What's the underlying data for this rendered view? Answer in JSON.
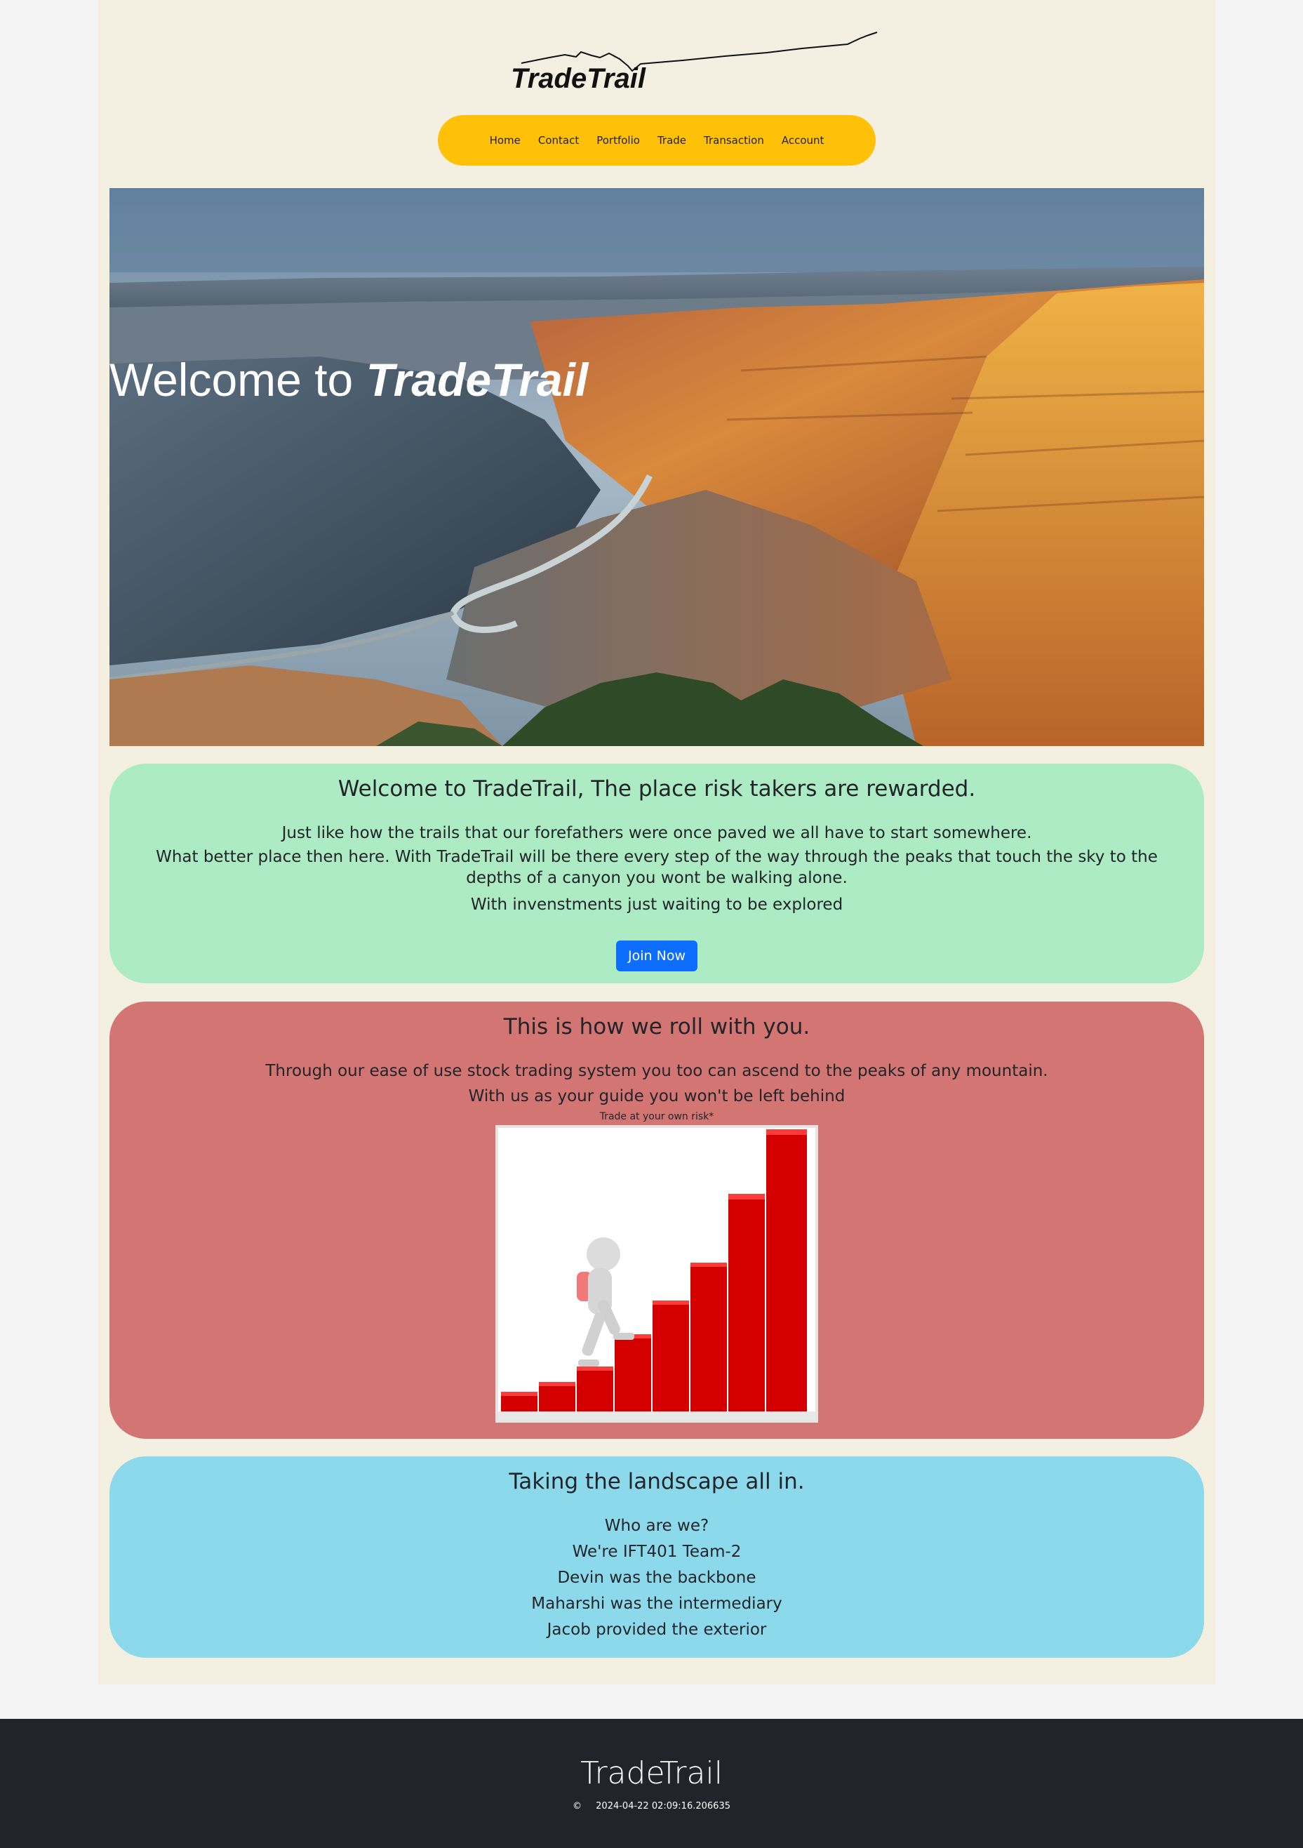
{
  "header": {
    "logo_text": "TradeTrail"
  },
  "nav": {
    "items": [
      {
        "label": "Home"
      },
      {
        "label": "Contact"
      },
      {
        "label": "Portfolio"
      },
      {
        "label": "Trade"
      },
      {
        "label": "Transaction"
      },
      {
        "label": "Account"
      }
    ],
    "background": "#ffc107"
  },
  "hero": {
    "title_prefix": "Welcome to ",
    "title_brand": "TradeTrail"
  },
  "welcome_panel": {
    "heading": "Welcome to TradeTrail, The place risk takers are rewarded.",
    "line1": "Just like how the trails that our forefathers were once paved we all have to start somewhere.",
    "line2": "What better place then here. With TradeTrail will be there every step of the way through the peaks that touch the sky to the depths of a canyon you wont be walking alone.",
    "line3": "With invenstments just waiting to be explored",
    "button": "Join Now",
    "background": "#acebc4"
  },
  "roll_panel": {
    "heading": "This is how we roll with you.",
    "line1": "Through our ease of use stock trading system you too can ascend to the peaks of any mountain.",
    "line2": "With us as your guide you won't be left behind",
    "note": "Trade at your own risk*",
    "background": "#d27573"
  },
  "about_panel": {
    "heading": "Taking the landscape all in.",
    "lines": [
      "Who are we?",
      "We're IFT401 Team-2",
      "Devin was the backbone",
      "Maharshi was the intermediary",
      "Jacob provided the exterior"
    ],
    "background": "#8dd9ec"
  },
  "footer": {
    "brand": "TradeTrail",
    "copyright": "©",
    "timestamp": "2024-04-22 02:09:16.206635"
  }
}
